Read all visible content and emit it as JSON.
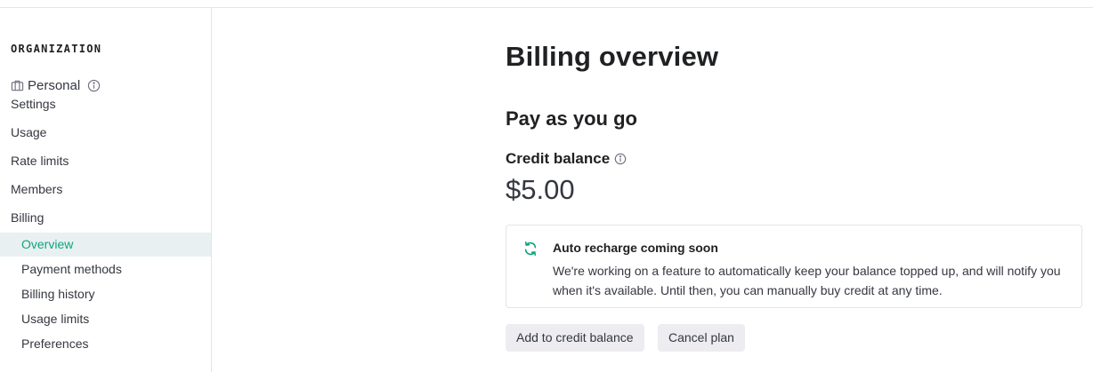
{
  "sidebar": {
    "section_title": "ORGANIZATION",
    "org_name": "Personal",
    "items": [
      {
        "label": "Settings"
      },
      {
        "label": "Usage"
      },
      {
        "label": "Rate limits"
      },
      {
        "label": "Members"
      },
      {
        "label": "Billing"
      }
    ],
    "billing_subitems": [
      {
        "label": "Overview",
        "active": true
      },
      {
        "label": "Payment methods"
      },
      {
        "label": "Billing history"
      },
      {
        "label": "Usage limits"
      },
      {
        "label": "Preferences"
      }
    ]
  },
  "main": {
    "title": "Billing overview",
    "plan_title": "Pay as you go",
    "credit_label": "Credit balance",
    "credit_amount": "$5.00",
    "notice": {
      "icon": "refresh-icon",
      "title": "Auto recharge coming soon",
      "body": "We're working on a feature to automatically keep your balance topped up, and will notify you when it's available. Until then, you can manually buy credit at any time."
    },
    "buttons": {
      "add_credit": "Add to credit balance",
      "cancel_plan": "Cancel plan"
    }
  },
  "colors": {
    "accent": "#10a37f",
    "active_bg": "#e8f0f1",
    "button_bg": "#ececf1",
    "border": "#e5e5e5"
  }
}
